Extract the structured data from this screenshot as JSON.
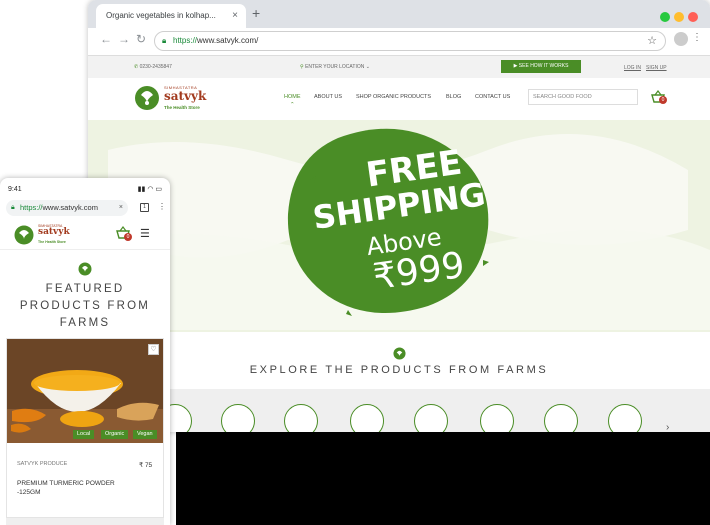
{
  "desktop": {
    "tab_title": "Organic vegetables in kolhap...",
    "tab_close": "×",
    "new_tab": "+",
    "window_dots": [
      "#27c93f",
      "#ffbd2e",
      "#ff5f56"
    ],
    "back": "←",
    "forward": "→",
    "reload": "↻",
    "url_proto": "https://",
    "url_rest": "www.satvyk.com/",
    "star": "☆",
    "menu": "⋮",
    "topbar": {
      "phone": "0230-2435847",
      "location": "ENTER YOUR LOCATION",
      "how_it_works": "SEE HOW IT WORKS",
      "login": "LOG IN",
      "signup": "SIGN UP"
    },
    "nav": {
      "home": "HOME",
      "about": "ABOUT US",
      "shop": "SHOP ORGANIC PRODUCTS",
      "blog": "BLOG",
      "contact": "CONTACT US"
    },
    "search_placeholder": "SEARCH GOOD FOOD",
    "cart_count": "0",
    "brand": {
      "small": "SIMHASTATRA",
      "name": "satvyk",
      "tagline": "The Health Store"
    },
    "hero": {
      "line1": "FREE",
      "line2": "SHIPPING",
      "line3": "Above",
      "line4": "₹999",
      "color": "#4a8d26"
    },
    "explore_title": "EXPLORE THE PRODUCTS FROM FARMS",
    "category_icons": [
      "honey-jar-icon",
      "oil-bottle-icon",
      "grain-icon",
      "pickle-jar-icon",
      "cream-tube-icon",
      "tea-cup-icon",
      "book-icon",
      "beverage-bottle-icon"
    ],
    "next": "›"
  },
  "mobile": {
    "time": "9:41",
    "status_icons": "▮▮ ◠ ▭",
    "url_proto": "https://",
    "url_rest": "www.satvyk.com",
    "url_close": "×",
    "tabs_count": "1",
    "kebab": "⋮",
    "cart_count": "0",
    "menu_icon": "☰",
    "featured_line1": "FEATURED",
    "featured_line2": "PRODUCTS FROM",
    "featured_line3": "FARMS",
    "product": {
      "brand": "SATVYK PRODUCE",
      "price": "₹ 75",
      "name": "PREMIUM TURMERIC POWDER -125GM",
      "tags": [
        "Local",
        "Organic",
        "Vegan"
      ],
      "wishlist": "♡"
    }
  }
}
